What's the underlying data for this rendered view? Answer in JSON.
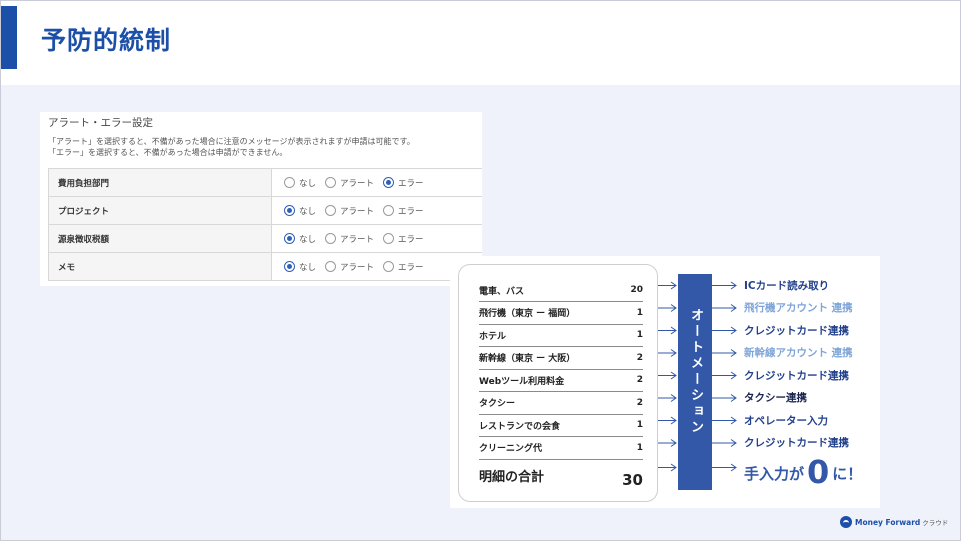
{
  "header": {
    "title": "予防的統制"
  },
  "settings": {
    "title": "アラート・エラー設定",
    "desc1": "「アラート」を選択すると、不備があった場合に注意のメッセージが表示されますが申請は可能です。",
    "desc2": "「エラー」を選択すると、不備があった場合は申請ができません。",
    "option_labels": [
      "なし",
      "アラート",
      "エラー"
    ],
    "rows": [
      {
        "label": "費用負担部門",
        "selected": "エラー"
      },
      {
        "label": "プロジェクト",
        "selected": "なし"
      },
      {
        "label": "源泉徴収税額",
        "selected": "なし"
      },
      {
        "label": "メモ",
        "selected": "なし"
      }
    ]
  },
  "automation": {
    "bar_label": "オートメーション",
    "items": [
      {
        "name": "電車、バス",
        "value": "20"
      },
      {
        "name": "飛行機（東京 ー 福岡）",
        "value": "1"
      },
      {
        "name": "ホテル",
        "value": "1"
      },
      {
        "name": "新幹線（東京 ー 大阪）",
        "value": "2"
      },
      {
        "name": "Webツール利用料金",
        "value": "2"
      },
      {
        "name": "タクシー",
        "value": "2"
      },
      {
        "name": "レストランでの会食",
        "value": "1"
      },
      {
        "name": "クリーニング代",
        "value": "1"
      }
    ],
    "total_label": "明細の合計",
    "total_value": "30",
    "results": [
      {
        "label": "ICカード読み取り",
        "tone": "dark"
      },
      {
        "label": "飛行機アカウント 連携",
        "tone": "light"
      },
      {
        "label": "クレジットカード連携",
        "tone": "dark"
      },
      {
        "label": "新幹線アカウント 連携",
        "tone": "light"
      },
      {
        "label": "クレジットカード連携",
        "tone": "dark"
      },
      {
        "label": "タクシー連携",
        "tone": "black"
      },
      {
        "label": "オペレーター入力",
        "tone": "dark"
      },
      {
        "label": "クレジットカード連携",
        "tone": "dark"
      }
    ],
    "final_prefix": "手入力が",
    "final_number": "0",
    "final_suffix": "に！"
  },
  "logo": {
    "brand": "Money Forward",
    "suffix": "クラウド"
  },
  "colors": {
    "primary": "#1c4fa8",
    "bar": "#3358a8",
    "light_blue": "#7fa5d8"
  }
}
